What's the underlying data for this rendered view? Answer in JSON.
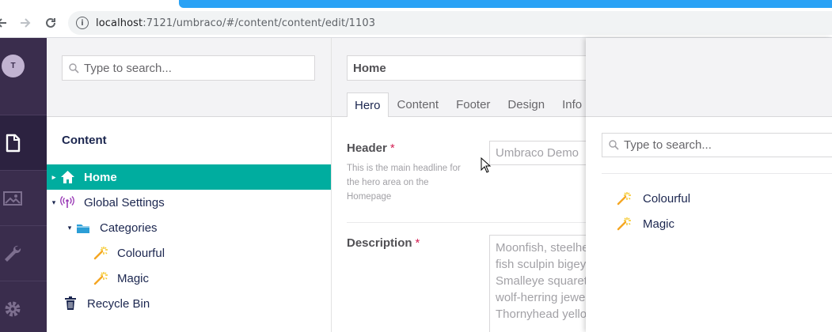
{
  "browser": {
    "url_host": "localhost",
    "url_rest": ":7121/umbraco/#/content/content/edit/1103",
    "back_icon": "arrow-left-icon",
    "forward_icon": "arrow-right-icon",
    "reload_icon": "reload-icon",
    "info_icon": "info-icon"
  },
  "sections": {
    "avatar_initial": "T",
    "items": [
      {
        "name": "content",
        "icon": "document-icon",
        "active": true
      },
      {
        "name": "media",
        "icon": "image-icon",
        "active": false
      },
      {
        "name": "settings",
        "icon": "wrench-icon",
        "active": false
      },
      {
        "name": "packages",
        "icon": "gear-icon",
        "active": false
      }
    ]
  },
  "tree": {
    "search_placeholder": "Type to search...",
    "title": "Content",
    "nodes": [
      {
        "label": "Home",
        "icon": "home-icon",
        "selected": true,
        "caret": "▸"
      },
      {
        "label": "Global Settings",
        "icon": "broadcast-icon",
        "selected": false,
        "caret": "▾"
      },
      {
        "label": "Categories",
        "icon": "folder-icon",
        "selected": false,
        "caret": "▾"
      },
      {
        "label": "Colourful",
        "icon": "magic-wand-icon",
        "selected": false,
        "caret": ""
      },
      {
        "label": "Magic",
        "icon": "magic-wand-icon",
        "selected": false,
        "caret": ""
      },
      {
        "label": "Recycle Bin",
        "icon": "trash-icon",
        "selected": false,
        "caret": ""
      }
    ]
  },
  "editor": {
    "name_value": "Home",
    "tabs": [
      "Hero",
      "Content",
      "Footer",
      "Design",
      "Info"
    ],
    "active_tab": "Hero",
    "header_label": "Header",
    "required_mark": "*",
    "header_description": "This is the main headline for the hero area on the Homepage",
    "header_value": "Umbraco Demo",
    "description_label": "Description",
    "description_lines": [
      "Moonfish, steelhe",
      "fish sculpin bigey",
      "Smalleye squareta",
      "wolf-herring jewe",
      "Thornyhead yello"
    ]
  },
  "overlay": {
    "search_placeholder": "Type to search...",
    "items": [
      {
        "label": "Colourful",
        "icon": "magic-wand-icon"
      },
      {
        "label": "Magic",
        "icon": "magic-wand-icon"
      }
    ]
  },
  "colors": {
    "section_bar": "#3a2d4d",
    "selected_node": "#00ad9f",
    "tab_accent": "#2aa2f5",
    "required": "#d42054"
  }
}
